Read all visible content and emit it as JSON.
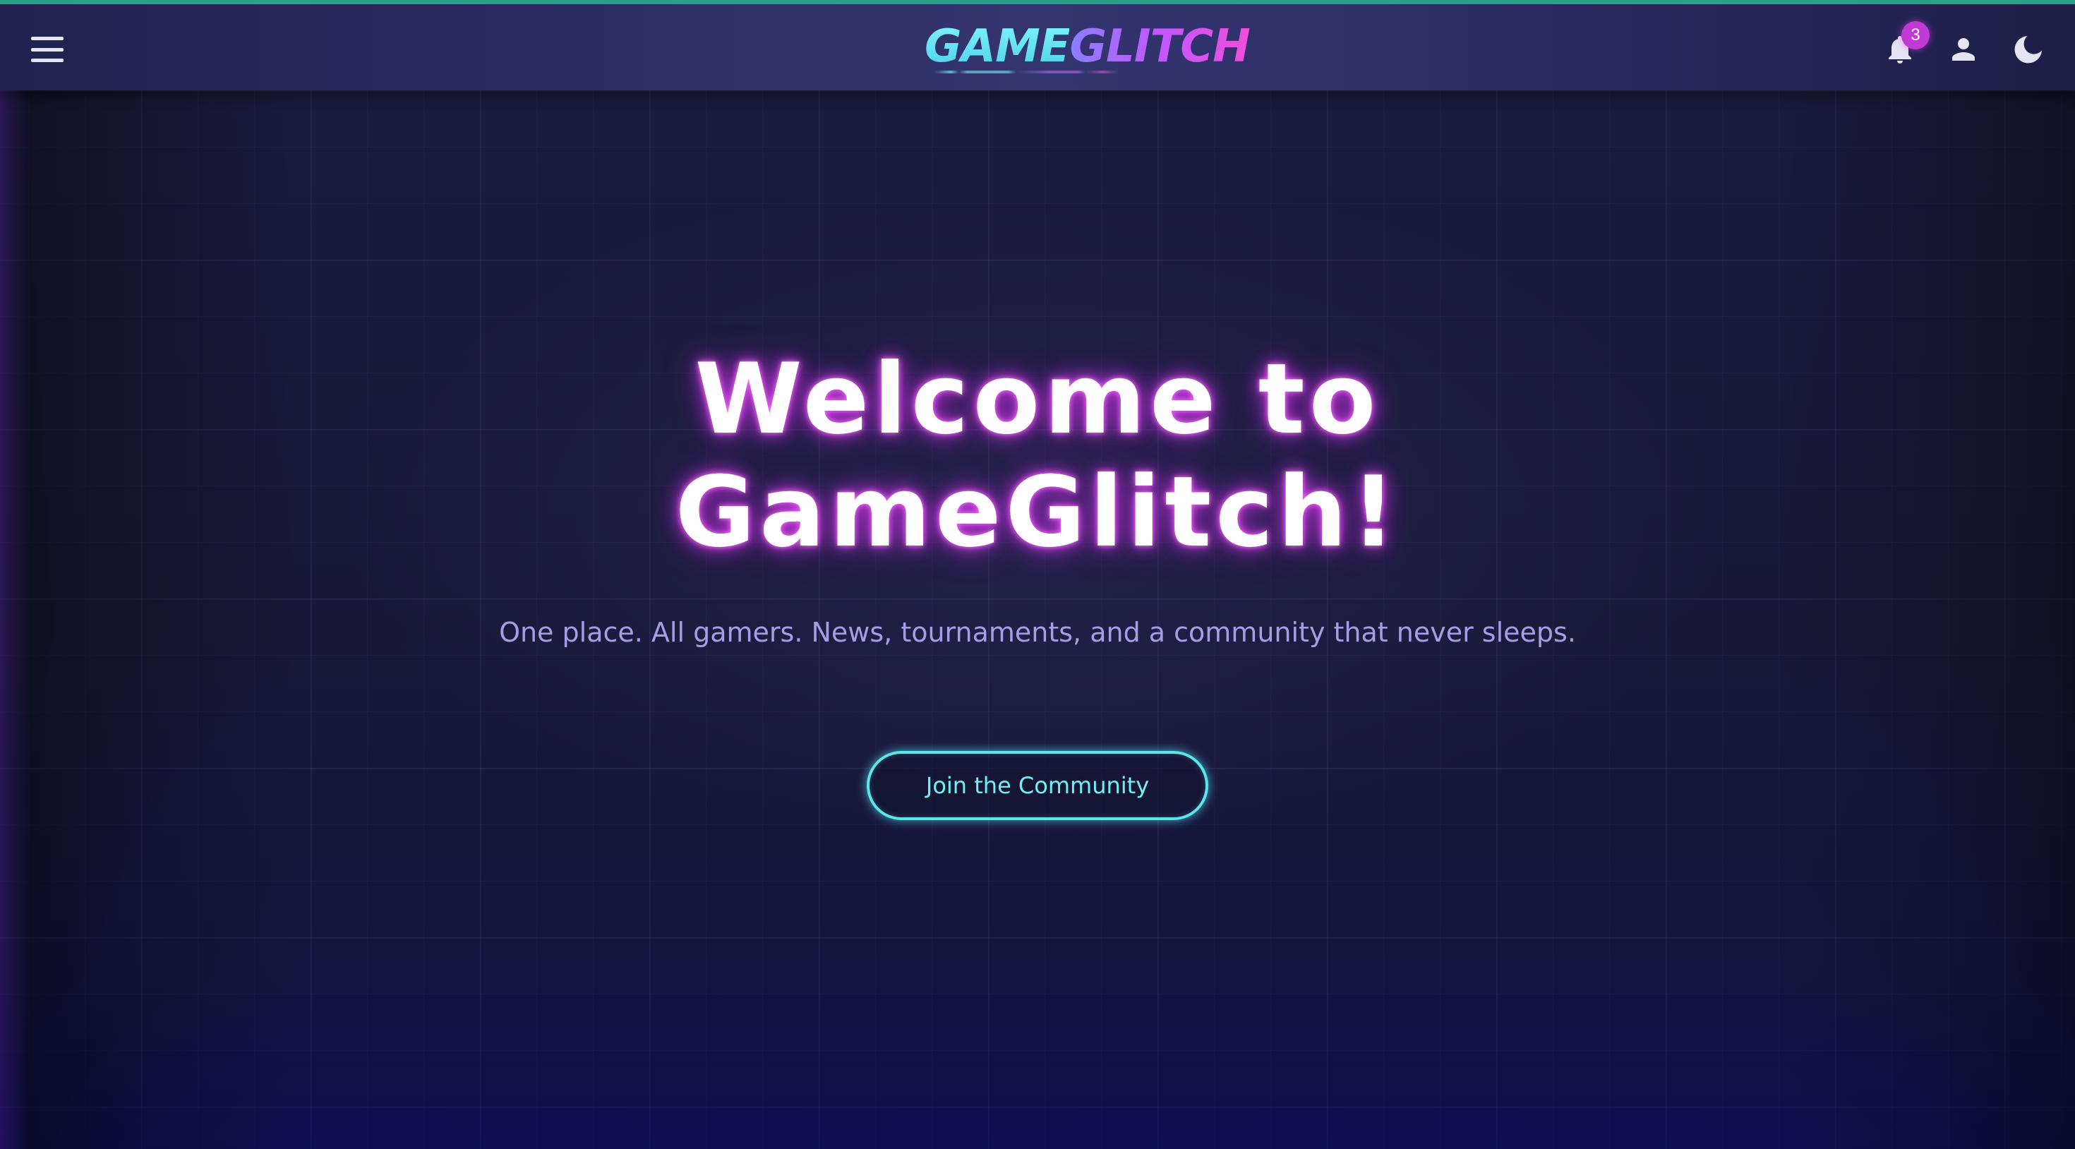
{
  "header": {
    "logo": {
      "part1": "GAME",
      "part2": "GLITCH"
    },
    "notifications": {
      "count": "3",
      "icon": "bell-icon"
    },
    "profile": {
      "icon": "user-icon"
    },
    "theme_toggle": {
      "icon": "moon-icon"
    },
    "menu": {
      "icon": "hamburger-icon"
    }
  },
  "hero": {
    "title_line1": "Welcome to",
    "title_line2": "GameGlitch!",
    "subtitle": "One place. All gamers. News, tournaments, and a community that never sleeps.",
    "cta_label": "Join the Community"
  },
  "colors": {
    "background": "#171732",
    "header": "#2d2d66",
    "accent_cyan": "#5de6ea",
    "accent_magenta": "#c23ad6",
    "subtitle": "#a79de6"
  }
}
